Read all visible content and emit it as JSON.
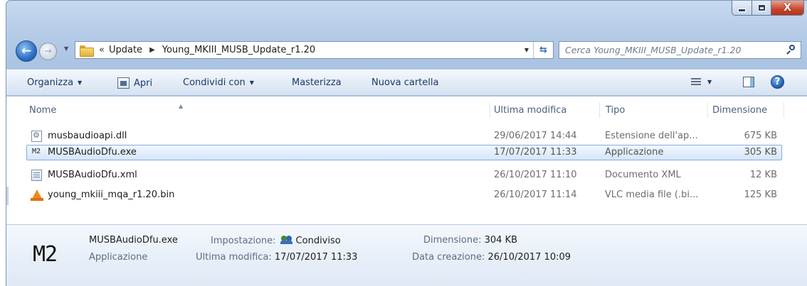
{
  "window": {
    "controls": {
      "close_glyph": "X"
    }
  },
  "address_bar": {
    "overflow": "«",
    "crumbs": [
      "Update",
      "Young_MKIII_MUSB_Update_r1.20"
    ]
  },
  "search": {
    "placeholder": "Cerca Young_MKIII_MUSB_Update_r1.20"
  },
  "commands": {
    "organize": "Organizza",
    "open": "Apri",
    "share": "Condividi con",
    "burn": "Masterizza",
    "new_folder": "Nuova cartella"
  },
  "columns": {
    "name": "Nome",
    "modified": "Ultima modifica",
    "type": "Tipo",
    "size": "Dimensione"
  },
  "files": [
    {
      "name": "musbaudioapi.dll",
      "modified": "29/06/2017 14:44",
      "type": "Estensione dell'ap...",
      "size": "675 KB",
      "icon": "dll-file-icon"
    },
    {
      "name": "MUSBAudioDfu.exe",
      "modified": "17/07/2017 11:33",
      "type": "Applicazione",
      "size": "305 KB",
      "icon": "exe-file-icon",
      "selected": true
    },
    {
      "name": "MUSBAudioDfu.xml",
      "modified": "26/10/2017 11:10",
      "type": "Documento XML",
      "size": "12 KB",
      "icon": "xml-file-icon"
    },
    {
      "name": "young_mkiii_mqa_r1.20.bin",
      "modified": "26/10/2017 11:14",
      "type": "VLC media file (.bi...",
      "size": "125 KB",
      "icon": "vlc-cone-icon"
    }
  ],
  "details": {
    "icon_text": "M2",
    "row_icon_text": "M2",
    "filename": "MUSBAudioDfu.exe",
    "filetype": "Applicazione",
    "sharing_label": "Impostazione:",
    "sharing_value": "Condiviso",
    "modified_label": "Ultima modifica:",
    "modified_value": "17/07/2017 11:33",
    "size_label": "Dimensione:",
    "size_value": "304 KB",
    "created_label": "Data creazione:",
    "created_value": "26/10/2017 10:09"
  }
}
